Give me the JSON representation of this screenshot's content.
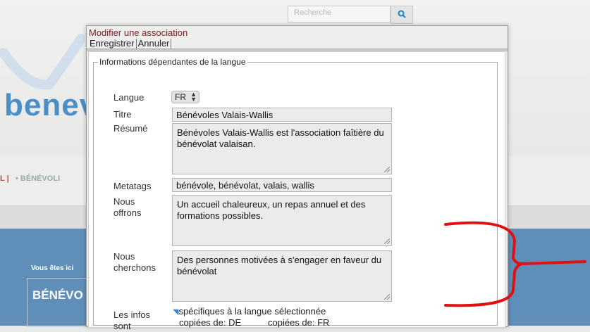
{
  "background": {
    "search_placeholder": "Recherche",
    "search_icon": "magnifier-icon",
    "logo_text": "benev",
    "nav_text_1": "L |",
    "nav_text_2": "• BÉNÉVOLI",
    "you_are_here": "Vous êtes ici",
    "page_heading_partial": "BÉNÉVO",
    "accent_color": "#4a8fc8"
  },
  "dialog": {
    "title": "Modifier une association",
    "menu": {
      "save_label": "Enregistrer",
      "cancel_label": "Annuler"
    },
    "fieldset_legend": "Informations dépendantes de la langue",
    "fields": {
      "langue_label": "Langue",
      "langue_value": "FR",
      "titre_label": "Titre",
      "titre_value": "Bénévoles Valais-Wallis",
      "resume_label": "Résumé",
      "resume_value": "Bénévoles Valais-Wallis est l'association faîtière du bénévolat valaisan.",
      "metatags_label": "Metatags",
      "metatags_value": "bénévole, bénévolat, valais, wallis",
      "offrons_label": "Nous offrons",
      "offrons_value": "Un accueil chaleureux, un repas annuel et des formations possibles.",
      "cherchons_label": "Nous cherchons",
      "cherchons_value": "Des personnes motivées à s'engager en faveur du bénévolat"
    },
    "infos": {
      "label": "Les infos sont",
      "option_specific": "spécifiques à la langue sélectionnée",
      "option_copy_de": "copiées de: DE",
      "option_copy_fr": "copiées de: FR"
    }
  },
  "annotation": {
    "type": "red-bracket-arrow",
    "color": "#e01010"
  }
}
